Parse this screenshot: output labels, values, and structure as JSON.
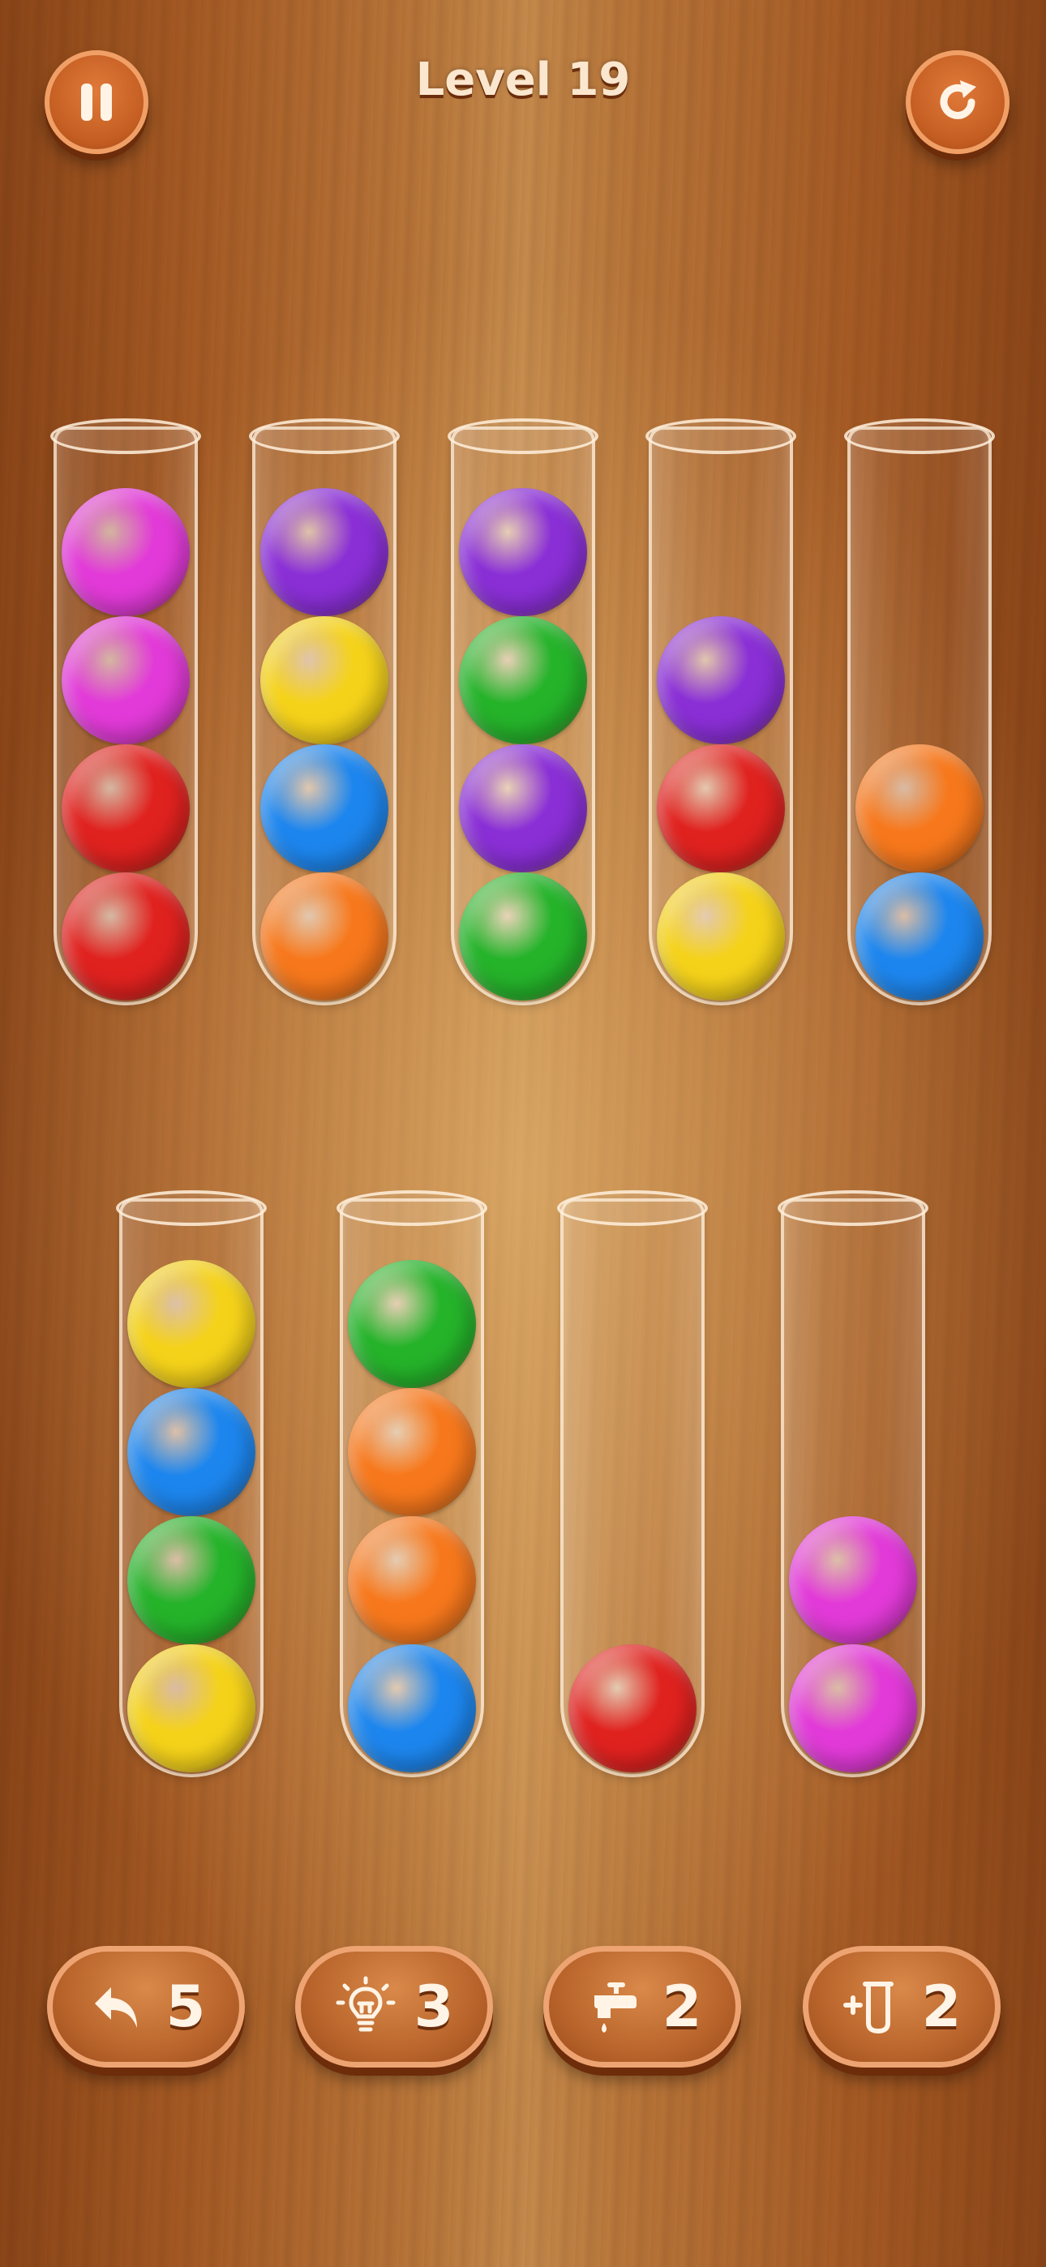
{
  "header": {
    "title": "Level 19",
    "pause_icon": "pause-icon",
    "restart_icon": "restart-icon"
  },
  "palette": {
    "magenta": "#e23ad8",
    "red": "#e0221f",
    "purple": "#8a2fd6",
    "yellow": "#f5d21a",
    "blue": "#1d86ee",
    "orange": "#f7781c",
    "green": "#25b32a"
  },
  "tubes": [
    {
      "balls_top_to_bottom": [
        "magenta",
        "magenta",
        "red",
        "red"
      ]
    },
    {
      "balls_top_to_bottom": [
        "purple",
        "yellow",
        "blue",
        "orange"
      ]
    },
    {
      "balls_top_to_bottom": [
        "purple",
        "green",
        "purple",
        "green"
      ]
    },
    {
      "balls_top_to_bottom": [
        "purple",
        "red",
        "yellow"
      ]
    },
    {
      "balls_top_to_bottom": [
        "orange",
        "blue"
      ]
    },
    {
      "balls_top_to_bottom": [
        "yellow",
        "blue",
        "green",
        "yellow"
      ]
    },
    {
      "balls_top_to_bottom": [
        "green",
        "orange",
        "orange",
        "blue"
      ]
    },
    {
      "balls_top_to_bottom": [
        "red"
      ]
    },
    {
      "balls_top_to_bottom": [
        "magenta",
        "magenta"
      ]
    }
  ],
  "tube_capacity": 4,
  "toolbar": {
    "undo": {
      "icon": "undo-arrow-icon",
      "count": "5"
    },
    "hint": {
      "icon": "lightbulb-icon",
      "count": "3"
    },
    "drain": {
      "icon": "faucet-icon",
      "count": "2"
    },
    "add_tube": {
      "icon": "add-tube-icon",
      "count": "2"
    }
  }
}
